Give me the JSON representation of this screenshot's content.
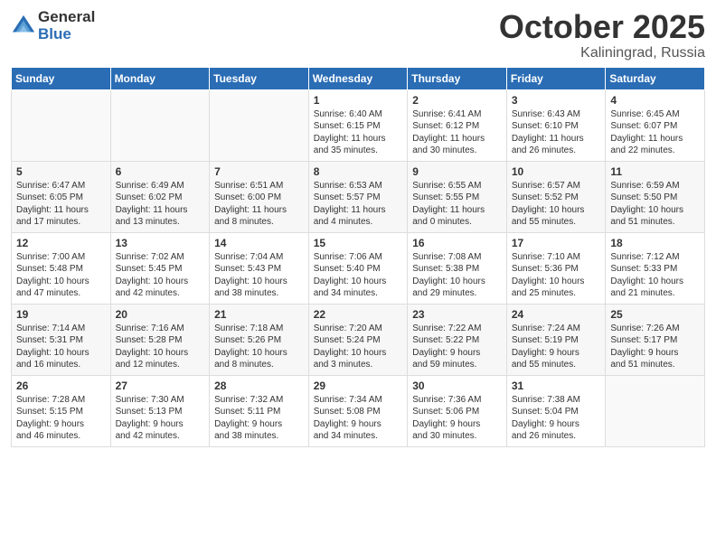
{
  "header": {
    "logo_general": "General",
    "logo_blue": "Blue",
    "month_title": "October 2025",
    "location": "Kaliningrad, Russia"
  },
  "days_of_week": [
    "Sunday",
    "Monday",
    "Tuesday",
    "Wednesday",
    "Thursday",
    "Friday",
    "Saturday"
  ],
  "weeks": [
    [
      {
        "day": "",
        "info": ""
      },
      {
        "day": "",
        "info": ""
      },
      {
        "day": "",
        "info": ""
      },
      {
        "day": "1",
        "info": "Sunrise: 6:40 AM\nSunset: 6:15 PM\nDaylight: 11 hours\nand 35 minutes."
      },
      {
        "day": "2",
        "info": "Sunrise: 6:41 AM\nSunset: 6:12 PM\nDaylight: 11 hours\nand 30 minutes."
      },
      {
        "day": "3",
        "info": "Sunrise: 6:43 AM\nSunset: 6:10 PM\nDaylight: 11 hours\nand 26 minutes."
      },
      {
        "day": "4",
        "info": "Sunrise: 6:45 AM\nSunset: 6:07 PM\nDaylight: 11 hours\nand 22 minutes."
      }
    ],
    [
      {
        "day": "5",
        "info": "Sunrise: 6:47 AM\nSunset: 6:05 PM\nDaylight: 11 hours\nand 17 minutes."
      },
      {
        "day": "6",
        "info": "Sunrise: 6:49 AM\nSunset: 6:02 PM\nDaylight: 11 hours\nand 13 minutes."
      },
      {
        "day": "7",
        "info": "Sunrise: 6:51 AM\nSunset: 6:00 PM\nDaylight: 11 hours\nand 8 minutes."
      },
      {
        "day": "8",
        "info": "Sunrise: 6:53 AM\nSunset: 5:57 PM\nDaylight: 11 hours\nand 4 minutes."
      },
      {
        "day": "9",
        "info": "Sunrise: 6:55 AM\nSunset: 5:55 PM\nDaylight: 11 hours\nand 0 minutes."
      },
      {
        "day": "10",
        "info": "Sunrise: 6:57 AM\nSunset: 5:52 PM\nDaylight: 10 hours\nand 55 minutes."
      },
      {
        "day": "11",
        "info": "Sunrise: 6:59 AM\nSunset: 5:50 PM\nDaylight: 10 hours\nand 51 minutes."
      }
    ],
    [
      {
        "day": "12",
        "info": "Sunrise: 7:00 AM\nSunset: 5:48 PM\nDaylight: 10 hours\nand 47 minutes."
      },
      {
        "day": "13",
        "info": "Sunrise: 7:02 AM\nSunset: 5:45 PM\nDaylight: 10 hours\nand 42 minutes."
      },
      {
        "day": "14",
        "info": "Sunrise: 7:04 AM\nSunset: 5:43 PM\nDaylight: 10 hours\nand 38 minutes."
      },
      {
        "day": "15",
        "info": "Sunrise: 7:06 AM\nSunset: 5:40 PM\nDaylight: 10 hours\nand 34 minutes."
      },
      {
        "day": "16",
        "info": "Sunrise: 7:08 AM\nSunset: 5:38 PM\nDaylight: 10 hours\nand 29 minutes."
      },
      {
        "day": "17",
        "info": "Sunrise: 7:10 AM\nSunset: 5:36 PM\nDaylight: 10 hours\nand 25 minutes."
      },
      {
        "day": "18",
        "info": "Sunrise: 7:12 AM\nSunset: 5:33 PM\nDaylight: 10 hours\nand 21 minutes."
      }
    ],
    [
      {
        "day": "19",
        "info": "Sunrise: 7:14 AM\nSunset: 5:31 PM\nDaylight: 10 hours\nand 16 minutes."
      },
      {
        "day": "20",
        "info": "Sunrise: 7:16 AM\nSunset: 5:28 PM\nDaylight: 10 hours\nand 12 minutes."
      },
      {
        "day": "21",
        "info": "Sunrise: 7:18 AM\nSunset: 5:26 PM\nDaylight: 10 hours\nand 8 minutes."
      },
      {
        "day": "22",
        "info": "Sunrise: 7:20 AM\nSunset: 5:24 PM\nDaylight: 10 hours\nand 3 minutes."
      },
      {
        "day": "23",
        "info": "Sunrise: 7:22 AM\nSunset: 5:22 PM\nDaylight: 9 hours\nand 59 minutes."
      },
      {
        "day": "24",
        "info": "Sunrise: 7:24 AM\nSunset: 5:19 PM\nDaylight: 9 hours\nand 55 minutes."
      },
      {
        "day": "25",
        "info": "Sunrise: 7:26 AM\nSunset: 5:17 PM\nDaylight: 9 hours\nand 51 minutes."
      }
    ],
    [
      {
        "day": "26",
        "info": "Sunrise: 7:28 AM\nSunset: 5:15 PM\nDaylight: 9 hours\nand 46 minutes."
      },
      {
        "day": "27",
        "info": "Sunrise: 7:30 AM\nSunset: 5:13 PM\nDaylight: 9 hours\nand 42 minutes."
      },
      {
        "day": "28",
        "info": "Sunrise: 7:32 AM\nSunset: 5:11 PM\nDaylight: 9 hours\nand 38 minutes."
      },
      {
        "day": "29",
        "info": "Sunrise: 7:34 AM\nSunset: 5:08 PM\nDaylight: 9 hours\nand 34 minutes."
      },
      {
        "day": "30",
        "info": "Sunrise: 7:36 AM\nSunset: 5:06 PM\nDaylight: 9 hours\nand 30 minutes."
      },
      {
        "day": "31",
        "info": "Sunrise: 7:38 AM\nSunset: 5:04 PM\nDaylight: 9 hours\nand 26 minutes."
      },
      {
        "day": "",
        "info": ""
      }
    ]
  ]
}
